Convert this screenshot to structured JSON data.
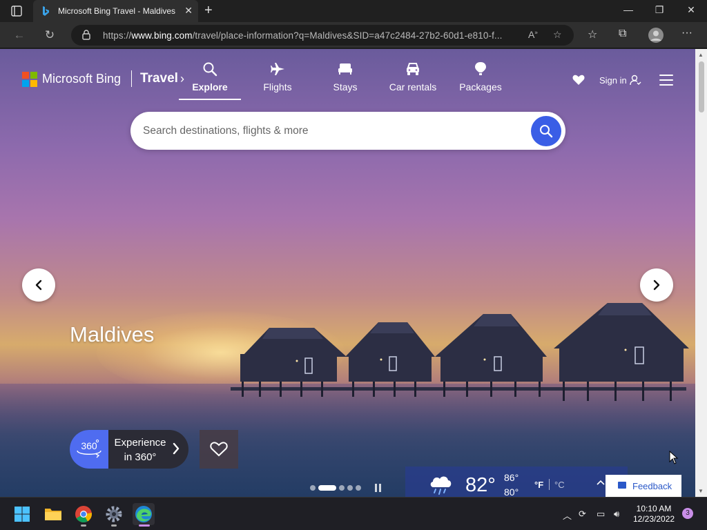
{
  "browser": {
    "tab_title": "Microsoft Bing Travel - Maldives",
    "url_prefix": "https://",
    "url_domain": "www.bing.com",
    "url_rest": "/travel/place-information?q=Maldives&SID=a47c2484-27b2-60d1-e810-f..."
  },
  "header": {
    "brand": "Microsoft Bing",
    "section": "Travel",
    "nav": [
      {
        "label": "Explore",
        "icon": "search-icon",
        "active": true
      },
      {
        "label": "Flights",
        "icon": "plane-icon",
        "active": false
      },
      {
        "label": "Stays",
        "icon": "bed-icon",
        "active": false
      },
      {
        "label": "Car rentals",
        "icon": "car-icon",
        "active": false
      },
      {
        "label": "Packages",
        "icon": "balloon-icon",
        "active": false
      }
    ],
    "sign_in": "Sign in"
  },
  "search": {
    "placeholder": "Search destinations, flights & more"
  },
  "hero": {
    "place": "Maldives",
    "experience_360_icon_text": "360",
    "experience_360_line1": "Experience",
    "experience_360_line2": "in 360°",
    "carousel_count": 5,
    "carousel_active": 1
  },
  "weather": {
    "icon": "rain-cloud-icon",
    "temp": "82°",
    "high": "86°",
    "low": "80°",
    "unit_f": "°F",
    "unit_c": "°C"
  },
  "feedback": {
    "label": "Feedback"
  },
  "taskbar": {
    "apps": [
      "windows-start",
      "file-explorer",
      "chrome",
      "settings",
      "edge"
    ],
    "time": "10:10 AM",
    "date": "12/23/2022",
    "notifications": "3"
  },
  "colors": {
    "accent_blue": "#3a5ee6",
    "feedback_blue": "#2a58c8"
  }
}
